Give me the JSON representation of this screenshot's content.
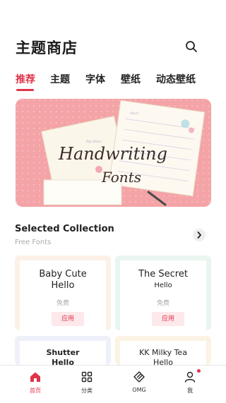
{
  "header": {
    "title": "主题商店"
  },
  "tabs": [
    {
      "label": "推荐",
      "active": true
    },
    {
      "label": "主题",
      "active": false
    },
    {
      "label": "字体",
      "active": false
    },
    {
      "label": "壁纸",
      "active": false
    },
    {
      "label": "动态壁纸",
      "active": false
    }
  ],
  "banner": {
    "line1": "Handwriting",
    "line2": "Fonts",
    "paper_label": "My Dear",
    "note_label": "Dear"
  },
  "section": {
    "title": "Selected Collection",
    "subtitle": "Free Fonts"
  },
  "cards": [
    {
      "name_line1": "Baby Cute",
      "name_line2": "Hello",
      "price": "免费",
      "action": "应用",
      "tint": "#fdf1e7"
    },
    {
      "name_line1": "The Secret",
      "name_line2": "Hello",
      "price": "免费",
      "action": "应用",
      "tint": "#e9f6f0"
    },
    {
      "name_line1": "Shutter",
      "name_line2": "Hello",
      "tint": "#eef0fa"
    },
    {
      "name_line1": "KK Milky Tea",
      "name_line2": "Hello",
      "tint": "#fbf3e3"
    }
  ],
  "nav": [
    {
      "label": "首页",
      "icon": "home-icon",
      "active": true
    },
    {
      "label": "分类",
      "icon": "grid-icon",
      "active": false
    },
    {
      "label": "OMG",
      "icon": "diamond-icon",
      "active": false
    },
    {
      "label": "我",
      "icon": "user-icon",
      "active": false
    }
  ],
  "colors": {
    "accent": "#e0344a",
    "banner_bg": "#f4a3a6"
  }
}
